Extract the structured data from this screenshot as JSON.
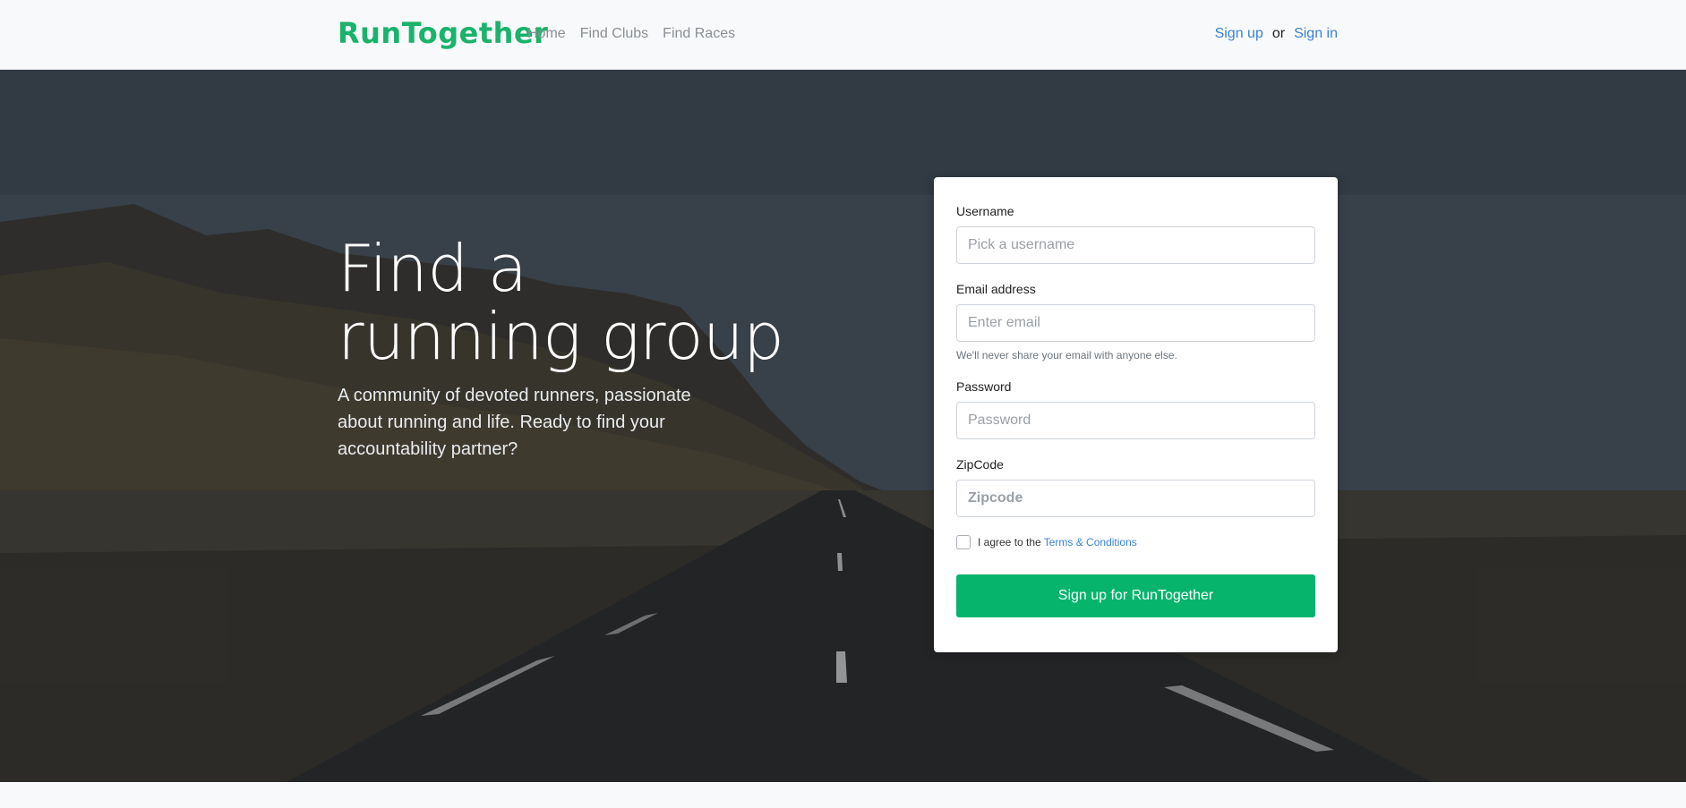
{
  "nav": {
    "brand": "RunTogether",
    "links": [
      "Home",
      "Find Clubs",
      "Find Races"
    ],
    "signup": "Sign up",
    "or": "or",
    "signin": "Sign in",
    "brand_color": "#1ab36b"
  },
  "hero": {
    "title": "Find a running group",
    "subtitle": "A community of devoted runners, passionate about running and life. Ready to find your accountability partner?"
  },
  "form": {
    "username": {
      "label": "Username",
      "placeholder": "Pick a username"
    },
    "email": {
      "label": "Email address",
      "placeholder": "Enter email",
      "help": "We'll never share your email with anyone else."
    },
    "password": {
      "label": "Password",
      "placeholder": "Password"
    },
    "zipcode": {
      "label": "ZipCode",
      "placeholder": "Zipcode"
    },
    "agree_prefix": "I agree to the",
    "terms_link": "Terms & Conditions",
    "submit": "Sign up for RunTogether",
    "submit_color": "#06b46c"
  }
}
